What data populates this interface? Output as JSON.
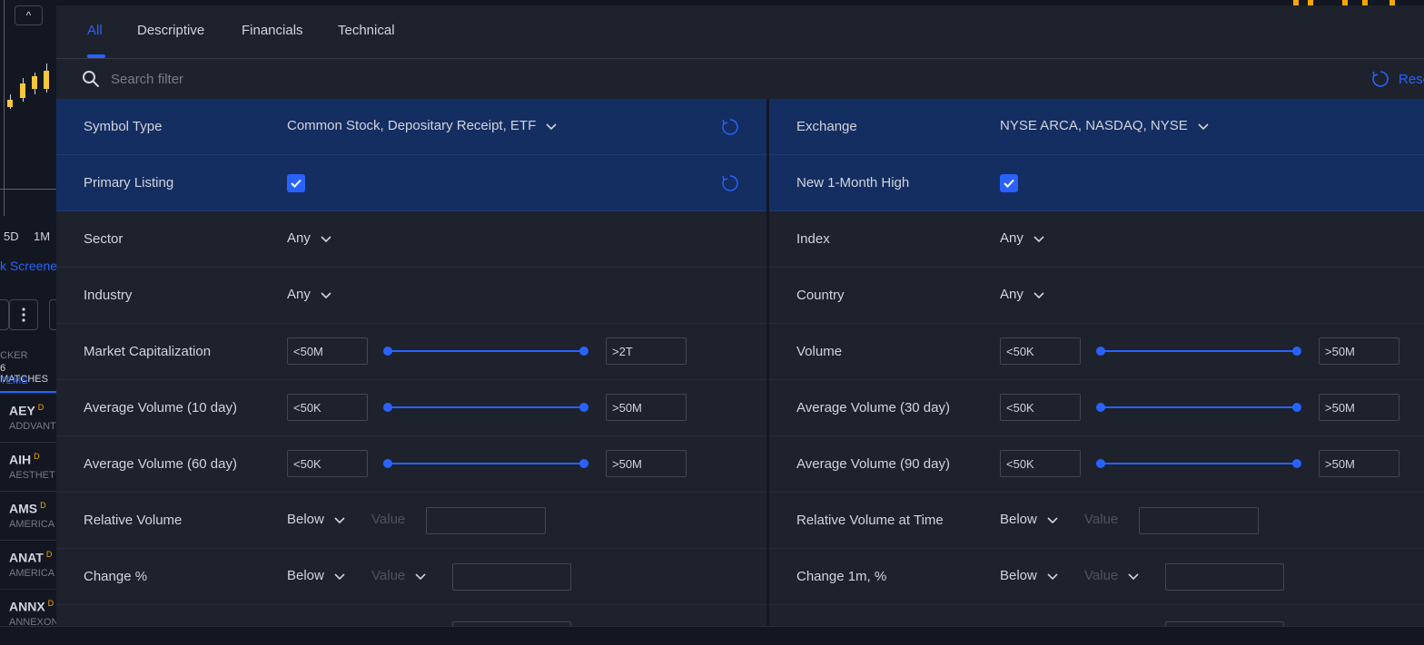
{
  "background": {
    "collapse_label": "^",
    "timeframes": [
      "5D",
      "1M"
    ],
    "screener_link": "k Screene",
    "header": {
      "ticker": "CKER",
      "matches": "6 MATCHES",
      "items": "TEMS"
    },
    "rows": [
      {
        "symbol": "AEY",
        "flag": "D",
        "name": "ADDVANT"
      },
      {
        "symbol": "AIH",
        "flag": "D",
        "name": "AESTHET"
      },
      {
        "symbol": "AMS",
        "flag": "D",
        "name": "AMERICA"
      },
      {
        "symbol": "ANAT",
        "flag": "D",
        "name": "AMERICA"
      },
      {
        "symbol": "ANNX",
        "flag": "D",
        "name": "ANNEXON, INC."
      }
    ]
  },
  "tabs": [
    {
      "label": "All",
      "active": true
    },
    {
      "label": "Descriptive",
      "active": false
    },
    {
      "label": "Financials",
      "active": false
    },
    {
      "label": "Technical",
      "active": false
    }
  ],
  "search": {
    "placeholder": "Search filter",
    "value": ""
  },
  "reset_all_label": "Reset",
  "filters": {
    "symbol_type": {
      "label": "Symbol Type",
      "value": "Common Stock, Depositary Receipt, ETF"
    },
    "exchange": {
      "label": "Exchange",
      "value": "NYSE ARCA, NASDAQ, NYSE"
    },
    "primary_listing": {
      "label": "Primary Listing",
      "checked": true
    },
    "new_1m_high": {
      "label": "New 1-Month High",
      "checked": true
    },
    "sector": {
      "label": "Sector",
      "value": "Any"
    },
    "index": {
      "label": "Index",
      "value": "Any"
    },
    "industry": {
      "label": "Industry",
      "value": "Any"
    },
    "country": {
      "label": "Country",
      "value": "Any"
    },
    "market_cap": {
      "label": "Market Capitalization",
      "min": "<50M",
      "max": ">2T",
      "range": [
        0,
        1
      ]
    },
    "volume": {
      "label": "Volume",
      "min": "<50K",
      "max": ">50M",
      "range": [
        0,
        1
      ]
    },
    "avg_vol_10": {
      "label": "Average Volume (10 day)",
      "min": "<50K",
      "max": ">50M",
      "range": [
        0,
        1
      ]
    },
    "avg_vol_30": {
      "label": "Average Volume (30 day)",
      "min": "<50K",
      "max": ">50M",
      "range": [
        0,
        1
      ]
    },
    "avg_vol_60": {
      "label": "Average Volume (60 day)",
      "min": "<50K",
      "max": ">50M",
      "range": [
        0,
        1
      ]
    },
    "avg_vol_90": {
      "label": "Average Volume (90 day)",
      "min": "<50K",
      "max": ">50M",
      "range": [
        0,
        1
      ]
    },
    "rel_volume": {
      "label": "Relative Volume",
      "condition": "Below",
      "value_placeholder": "Value",
      "value": ""
    },
    "rel_volume_time": {
      "label": "Relative Volume at Time",
      "condition": "Below",
      "value_placeholder": "Value",
      "value": ""
    },
    "change_pct": {
      "label": "Change %",
      "condition": "Below",
      "unit_label": "Value",
      "value": ""
    },
    "change_1m": {
      "label": "Change 1m, %",
      "condition": "Below",
      "unit_label": "Value",
      "value": ""
    }
  },
  "colors": {
    "accent": "#2962ff",
    "selected_row": "#142e61",
    "panel": "#1e222d",
    "candle": "#f7c73d"
  }
}
